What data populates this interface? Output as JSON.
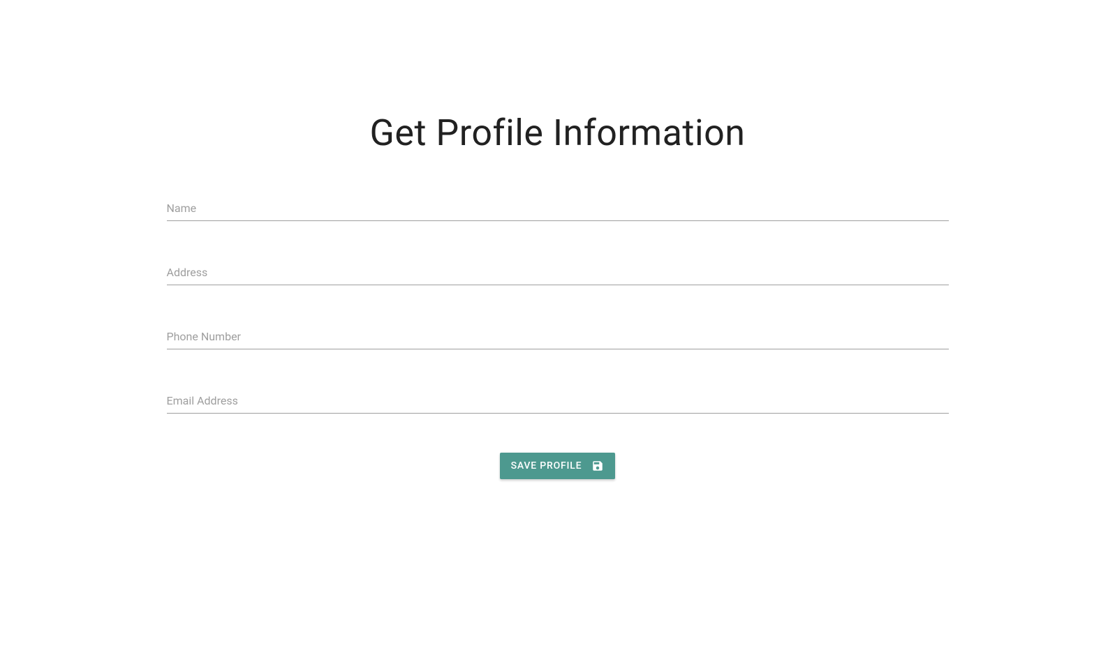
{
  "page": {
    "title": "Get Profile Information"
  },
  "form": {
    "fields": {
      "name": {
        "label": "Name",
        "value": ""
      },
      "address": {
        "label": "Address",
        "value": ""
      },
      "phone": {
        "label": "Phone Number",
        "value": ""
      },
      "email": {
        "label": "Email Address",
        "value": ""
      }
    },
    "save_button_label": "SAVE PROFILE"
  }
}
